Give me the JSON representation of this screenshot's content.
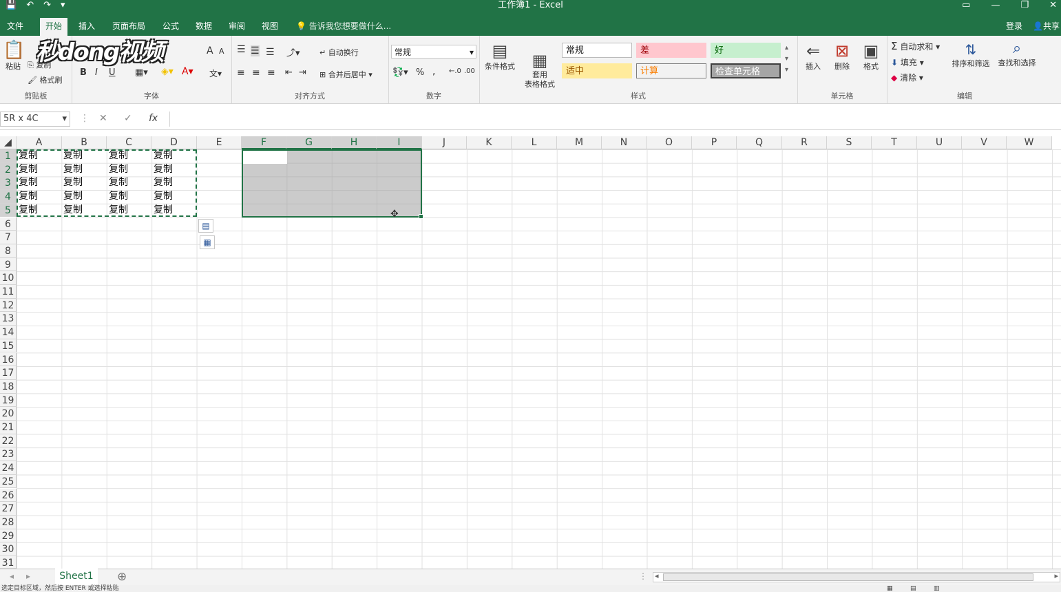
{
  "window": {
    "title": "工作簿1 - Excel"
  },
  "qat": {
    "save": "💾",
    "undo": "↶",
    "redo": "↷",
    "more": "▾"
  },
  "tabs": [
    "文件",
    "开始",
    "插入",
    "页面布局",
    "公式",
    "数据",
    "审阅",
    "视图"
  ],
  "tellme": "告诉我您想要做什么...",
  "account": {
    "login": "登录",
    "share": "共享"
  },
  "ribbon": {
    "clipboard": {
      "label": "剪贴板",
      "paste": "粘贴",
      "copy": "复制",
      "format_painter": "格式刷"
    },
    "font": {
      "label": "字体",
      "bold": "B",
      "italic": "I",
      "underline": "U",
      "grow": "A",
      "shrink": "A"
    },
    "alignment": {
      "label": "对齐方式",
      "wrap": "自动换行",
      "merge": "合并后居中"
    },
    "number": {
      "label": "数字",
      "format": "常规",
      "percent": "%",
      "comma": ","
    },
    "styles": {
      "label": "样式",
      "conditional": "条件格式",
      "table": "套用\n表格格式",
      "normal": "常规",
      "bad": "差",
      "good": "好",
      "neutral": "适中",
      "calc": "计算",
      "check": "检查单元格"
    },
    "cells": {
      "label": "单元格",
      "insert": "插入",
      "delete": "删除",
      "format": "格式"
    },
    "editing": {
      "label": "编辑",
      "autosum": "自动求和",
      "fill": "填充",
      "clear": "清除",
      "sort": "排序和筛选",
      "find": "查找和选择"
    }
  },
  "formula_bar": {
    "namebox": "5R x 4C",
    "cancel": "✕",
    "enter": "✓",
    "fx": "fx"
  },
  "columns": [
    "A",
    "B",
    "C",
    "D",
    "E",
    "F",
    "G",
    "H",
    "I",
    "J",
    "K",
    "L",
    "M",
    "N",
    "O",
    "P",
    "Q",
    "R",
    "S",
    "T",
    "U",
    "V",
    "W"
  ],
  "rows": [
    "1",
    "2",
    "3",
    "4",
    "5",
    "6",
    "7",
    "8",
    "9",
    "10",
    "11",
    "12",
    "13",
    "14",
    "15",
    "16",
    "17",
    "18",
    "19",
    "20",
    "21",
    "22",
    "23",
    "24",
    "25",
    "26",
    "27",
    "28",
    "29",
    "30",
    "31"
  ],
  "cell_text": "复制",
  "sheet": {
    "name": "Sheet1",
    "add": "⊕"
  },
  "status": "选定目标区域，然后按 ENTER 或选择粘贴",
  "watermark": "秒dong视频",
  "colors": {
    "brand": "#217346",
    "bad_bg": "#ffc7ce",
    "bad_fg": "#9c0006",
    "good_bg": "#c6efce",
    "good_fg": "#006100",
    "neutral_bg": "#ffeb9c",
    "neutral_fg": "#9c5700",
    "calc_fg": "#fa7d00",
    "check_bg": "#a5a5a5"
  }
}
